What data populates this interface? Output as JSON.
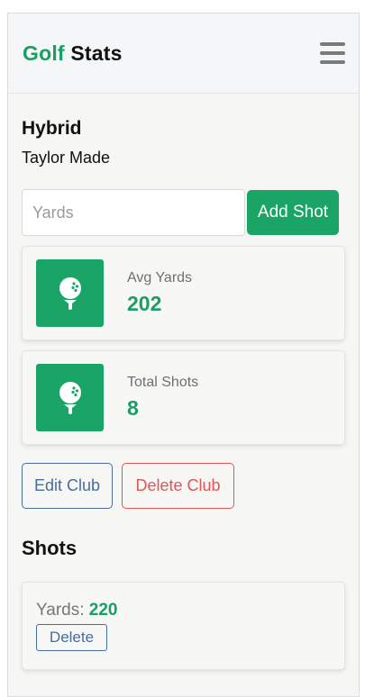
{
  "navbar": {
    "brand_accent": "Golf",
    "brand_rest": "Stats",
    "menu_icon": "hamburger-menu-icon"
  },
  "club": {
    "name": "Hybrid",
    "brand": "Taylor Made"
  },
  "shot_form": {
    "yards_placeholder": "Yards",
    "yards_value": "",
    "add_label": "Add Shot"
  },
  "stats": [
    {
      "label": "Avg Yards",
      "value": "202",
      "icon": "golf-ball-on-tee-icon"
    },
    {
      "label": "Total Shots",
      "value": "8",
      "icon": "golf-ball-on-tee-icon"
    }
  ],
  "club_actions": {
    "edit_label": "Edit Club",
    "delete_label": "Delete Club"
  },
  "shots": {
    "heading": "Shots",
    "items": [
      {
        "yards_label": "Yards:",
        "yards_value": "220",
        "delete_label": "Delete"
      }
    ]
  },
  "colors": {
    "accent": "#1aa566",
    "edit": "#4a6d9c",
    "danger": "#e05656"
  }
}
